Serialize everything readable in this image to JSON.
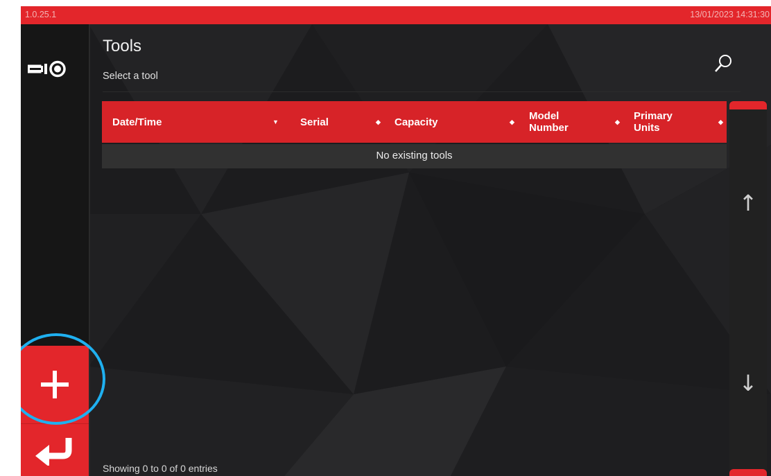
{
  "topbar": {
    "version": "1.0.25.1",
    "datetime": "13/01/2023 14:31:30"
  },
  "sidebar": {
    "app_icon": "tool-icon",
    "add_icon": "plus-icon",
    "back_icon": "return-arrow-icon"
  },
  "header": {
    "title": "Tools",
    "subtitle": "Select a tool",
    "search_icon": "search-icon"
  },
  "table": {
    "columns": [
      {
        "label": "Date/Time"
      },
      {
        "label": "Serial"
      },
      {
        "label": "Capacity"
      },
      {
        "label": "Model Number"
      },
      {
        "label": "Primary Units"
      }
    ],
    "empty_message": "No existing tools"
  },
  "scrollbar": {
    "up_icon": "arrow-up-icon",
    "down_icon": "arrow-down-icon"
  },
  "footer": {
    "info": "Showing 0 to 0 of 0 entries"
  },
  "colors": {
    "accent": "#e3262b",
    "background": "#1c1c1e",
    "highlight": "#1fb0f0"
  }
}
